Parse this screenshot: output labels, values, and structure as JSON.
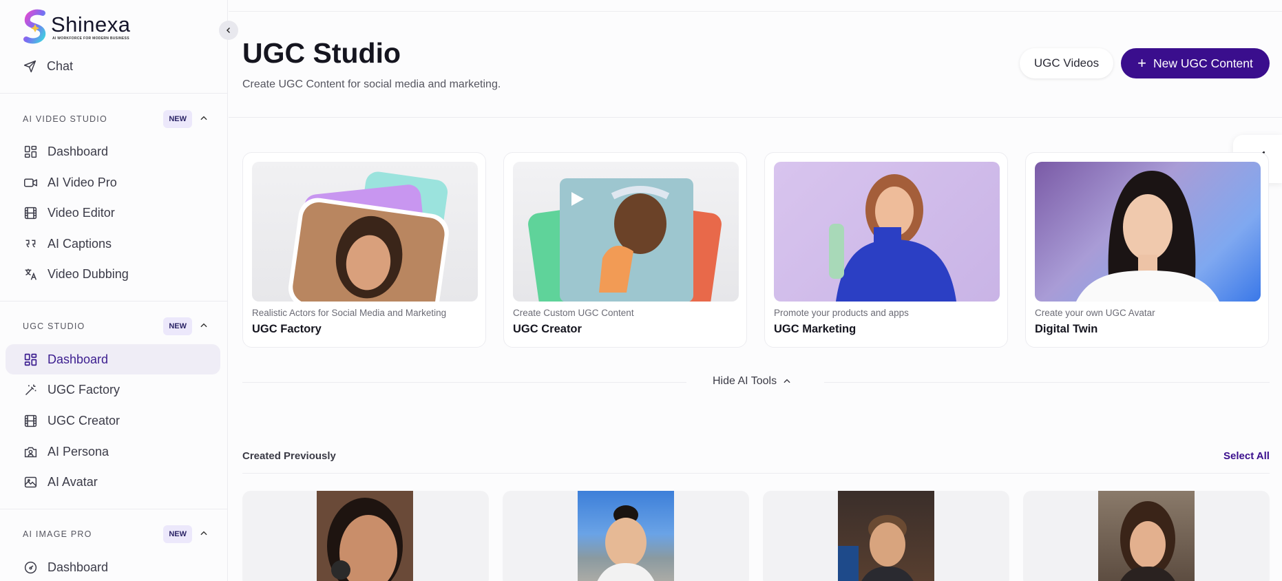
{
  "brand": {
    "name": "Shinexa",
    "tagline": "AI WORKFORCE FOR MODERN BUSINESS"
  },
  "sidebar": {
    "chat_label": "Chat",
    "sections": [
      {
        "title": "AI VIDEO STUDIO",
        "badge": "NEW",
        "items": [
          {
            "label": "Dashboard",
            "icon": "dashboard-icon"
          },
          {
            "label": "AI Video Pro",
            "icon": "video-camera-icon"
          },
          {
            "label": "Video Editor",
            "icon": "film-icon"
          },
          {
            "label": "AI Captions",
            "icon": "quote-icon"
          },
          {
            "label": "Video Dubbing",
            "icon": "translate-icon"
          }
        ]
      },
      {
        "title": "UGC STUDIO",
        "badge": "NEW",
        "items": [
          {
            "label": "Dashboard",
            "icon": "dashboard-icon",
            "active": true
          },
          {
            "label": "UGC Factory",
            "icon": "magic-wand-icon"
          },
          {
            "label": "UGC Creator",
            "icon": "film-icon"
          },
          {
            "label": "AI Persona",
            "icon": "camera-person-icon"
          },
          {
            "label": "AI Avatar",
            "icon": "image-icon"
          }
        ]
      },
      {
        "title": "AI IMAGE PRO",
        "badge": "NEW",
        "items": [
          {
            "label": "Dashboard",
            "icon": "gauge-icon"
          }
        ]
      }
    ]
  },
  "header": {
    "title": "UGC Studio",
    "subtitle": "Create UGC Content for social media and marketing.",
    "videos_button": "UGC Videos",
    "new_button": "New UGC Content"
  },
  "tools": [
    {
      "caption": "Realistic Actors for Social Media and Marketing",
      "name": "UGC Factory"
    },
    {
      "caption": "Create Custom UGC Content",
      "name": "UGC Creator"
    },
    {
      "caption": "Promote your products and apps",
      "name": "UGC Marketing"
    },
    {
      "caption": "Create your own UGC Avatar",
      "name": "Digital Twin"
    }
  ],
  "hide_tools_label": "Hide AI Tools",
  "created": {
    "title": "Created Previously",
    "select_all": "Select All"
  },
  "colors": {
    "accent": "#3a0e8d",
    "active_bg": "#efedf6",
    "badge_bg": "#ece8fb"
  }
}
